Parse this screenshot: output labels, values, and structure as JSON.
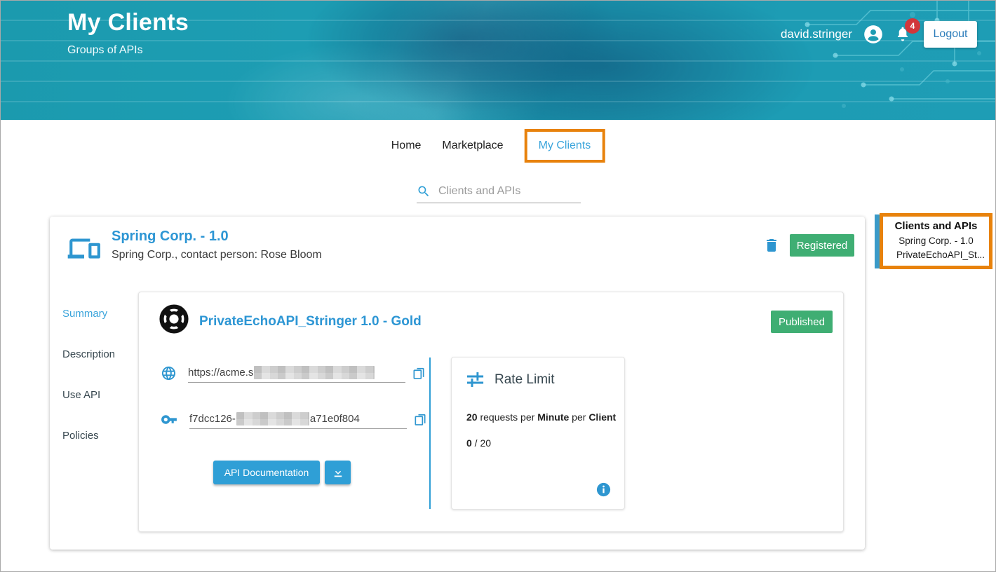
{
  "header": {
    "title": "My Clients",
    "subtitle": "Groups of APIs",
    "username": "david.stringer",
    "notification_count": "4",
    "logout_label": "Logout"
  },
  "nav": {
    "items": [
      {
        "label": "Home",
        "active": false
      },
      {
        "label": "Marketplace",
        "active": false
      },
      {
        "label": "My Clients",
        "active": true
      }
    ]
  },
  "search": {
    "placeholder": "Clients and APIs"
  },
  "client_card": {
    "title": "Spring Corp. - 1.0",
    "subtitle": "Spring Corp., contact person: Rose Bloom",
    "status": "Registered",
    "tabs": [
      {
        "label": "Summary",
        "active": true
      },
      {
        "label": "Description",
        "active": false
      },
      {
        "label": "Use API",
        "active": false
      },
      {
        "label": "Policies",
        "active": false
      }
    ]
  },
  "api_card": {
    "title": "PrivateEchoAPI_Stringer 1.0 - Gold",
    "status": "Published",
    "endpoint_visible_prefix": "https://acme.s",
    "endpoint_redacted": true,
    "key_visible_prefix": "f7dcc126-",
    "key_visible_suffix": "a71e0f804",
    "key_redacted_middle": true,
    "doc_button_label": "API Documentation",
    "rate_limit": {
      "title": "Rate Limit",
      "limit": "20",
      "text_requests_per": " requests per ",
      "period": "Minute",
      "text_per": " per ",
      "subject": "Client",
      "used": "0",
      "separator": " / ",
      "total": "20"
    }
  },
  "annotation_panel": {
    "title": "Clients and APIs",
    "item_client": "Spring Corp. - 1.0",
    "item_api": "PrivateEchoAPI_St..."
  },
  "icons": {
    "avatar": "account-circle",
    "bell": "notifications",
    "search": "magnifier",
    "client": "devices",
    "delete": "trash",
    "api": "lifebuoy",
    "endpoint": "globe",
    "key": "vpn-key",
    "copy": "content-copy",
    "download": "download-tray",
    "rate": "tune-sliders",
    "info": "info-circle"
  },
  "colors": {
    "header_teal": "#1d9cb2",
    "accent_blue": "#2f9fd6",
    "nav_active_blue": "#3aa4db",
    "badge_green": "#3fae73",
    "annotation_orange": "#e8820c",
    "notification_red": "#d1363b"
  }
}
